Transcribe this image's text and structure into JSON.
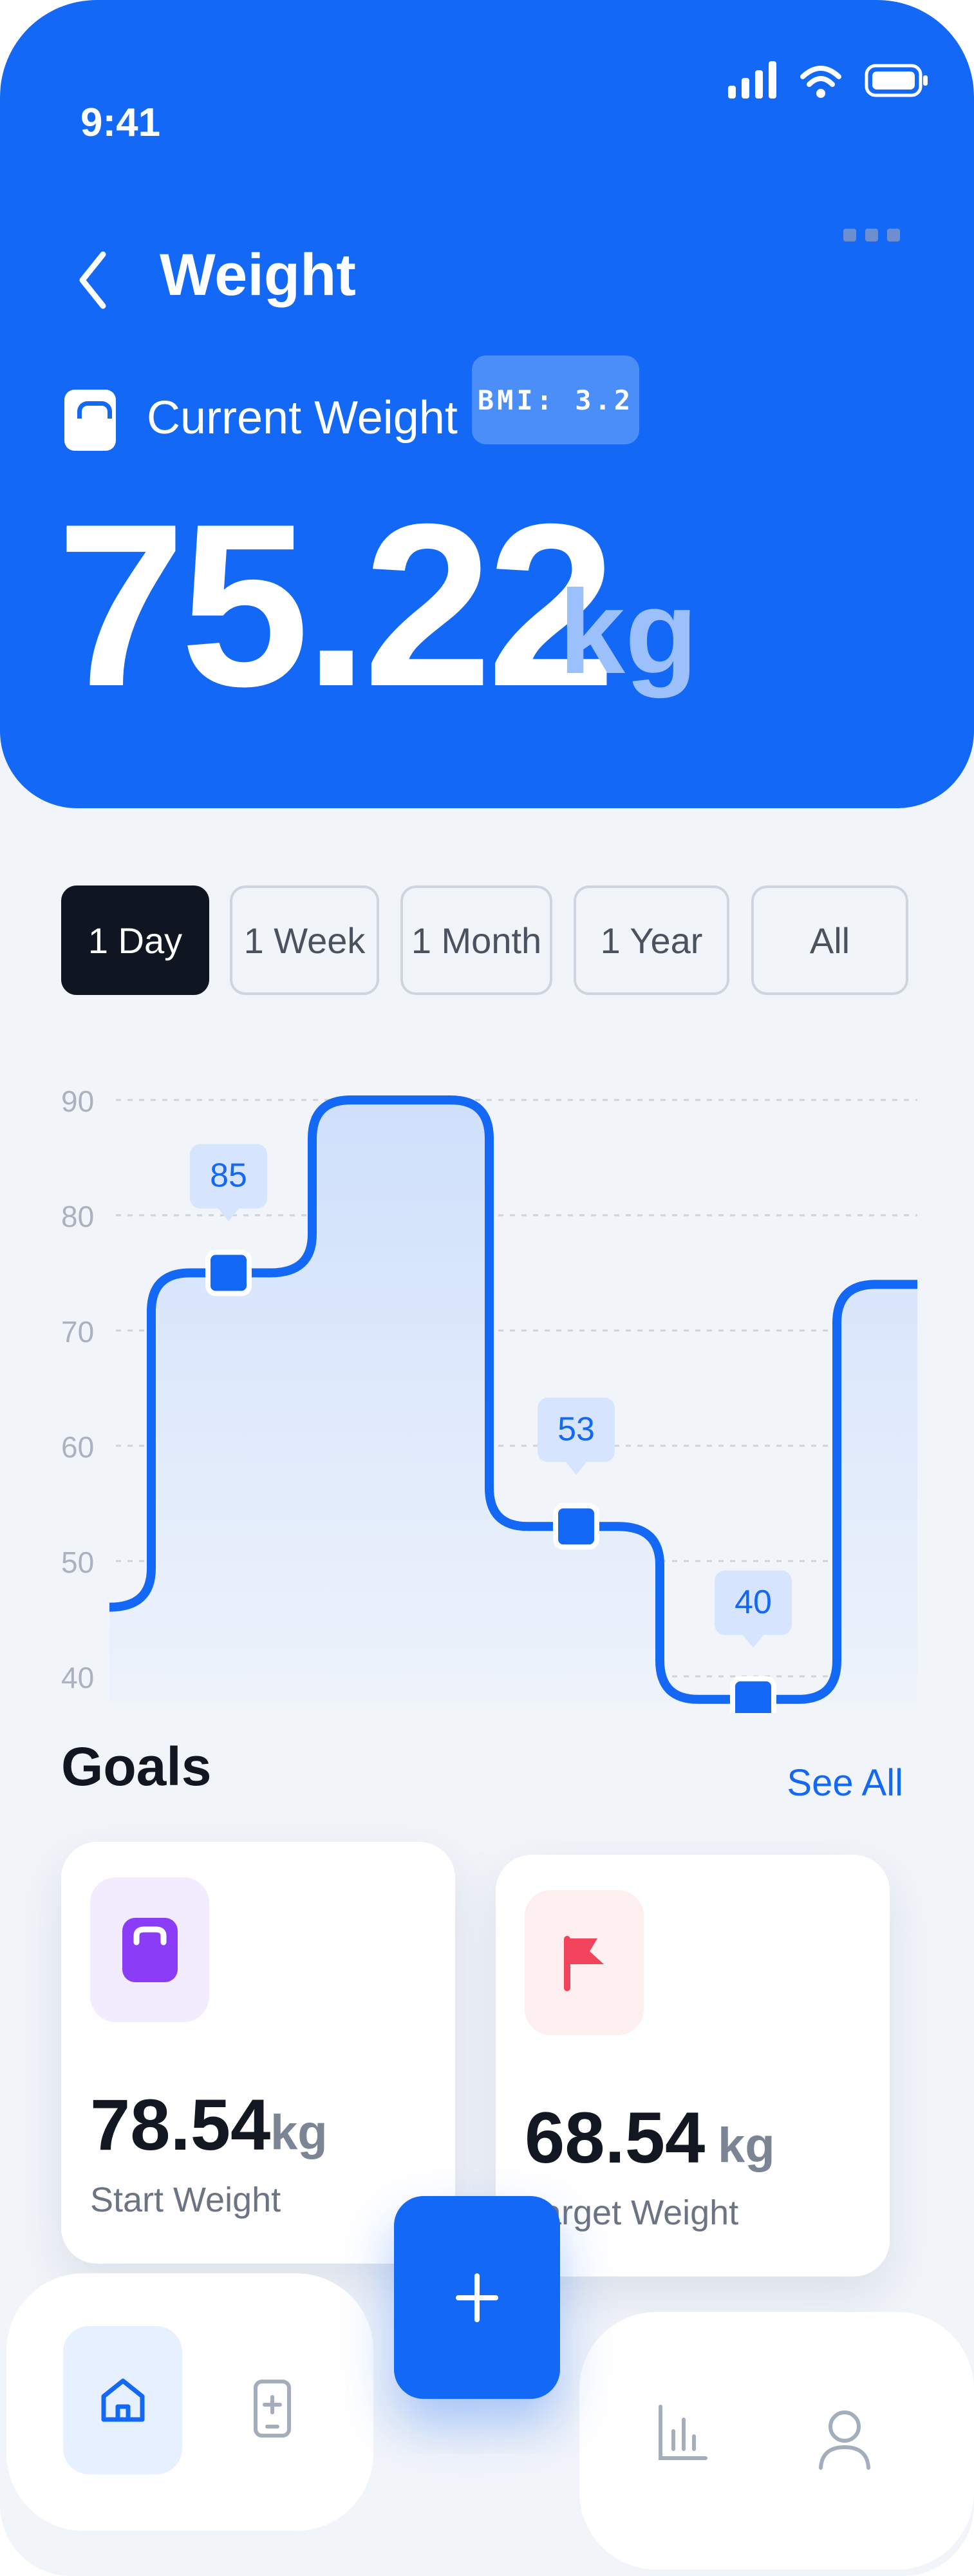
{
  "status_bar": {
    "time": "9:41"
  },
  "header": {
    "title": "Weight",
    "current_label": "Current Weight",
    "bmi": "BMI: 3.2",
    "weight_value": "75.22",
    "weight_unit": "kg"
  },
  "range_tabs": [
    "1 Day",
    "1 Week",
    "1 Month",
    "1 Year",
    "All"
  ],
  "active_range": "1 Day",
  "chart_data": {
    "type": "line",
    "y_ticks": [
      90,
      80,
      70,
      60,
      50,
      40
    ],
    "ylim": [
      40,
      90
    ],
    "grid": true,
    "points": [
      {
        "y": 46
      },
      {
        "y": 75
      },
      {
        "y": 90
      },
      {
        "y": 53
      },
      {
        "y": 38
      },
      {
        "y": 74
      }
    ],
    "callouts": [
      "85",
      "53",
      "40"
    ]
  },
  "goals": {
    "title": "Goals",
    "see_all": "See All",
    "cards": [
      {
        "value": "78.54",
        "unit": "kg",
        "label": "Start Weight",
        "icon": "weight-scale-icon",
        "accent": "#8b3cf6",
        "tint": "#f2ecfe"
      },
      {
        "value": "68.54",
        "unit": "kg",
        "label": "Target Weight",
        "icon": "flag-icon",
        "accent": "#f2435c",
        "tint": "#fdeef0"
      }
    ]
  },
  "nav": {
    "items": [
      "home-icon",
      "device-add-icon",
      "add-icon",
      "bar-chart-icon",
      "profile-icon"
    ],
    "accent": "#1368f5"
  }
}
